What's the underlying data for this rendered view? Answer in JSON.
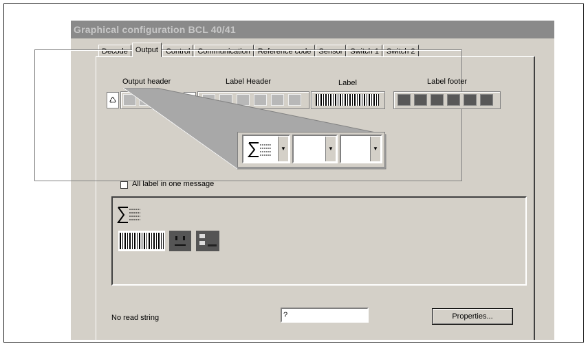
{
  "window": {
    "title": "Graphical configuration BCL 40/41"
  },
  "tabs": [
    {
      "label": "Decode"
    },
    {
      "label": "Output"
    },
    {
      "label": "Control"
    },
    {
      "label": "Communication"
    },
    {
      "label": "Reference code"
    },
    {
      "label": "Sensor"
    },
    {
      "label": "Switch 1"
    },
    {
      "label": "Switch 2"
    }
  ],
  "active_tab": "Output",
  "output": {
    "output_header_label": "Output header",
    "label_header_label": "Label Header",
    "label_label": "Label",
    "label_footer_label": "Label footer",
    "rotate_glyph": "♺",
    "combo_arrow": "▼",
    "all_label_checkbox": {
      "label": "All label in one message",
      "checked": false
    },
    "no_read_string": {
      "label": "No read string",
      "value": "?"
    },
    "properties_button": "Properties..."
  },
  "icons": [
    "sum-list-icon",
    "barcode-icon",
    "socket-icon",
    "form-icon",
    "rotate-icon",
    "dropdown-arrow-icon"
  ]
}
